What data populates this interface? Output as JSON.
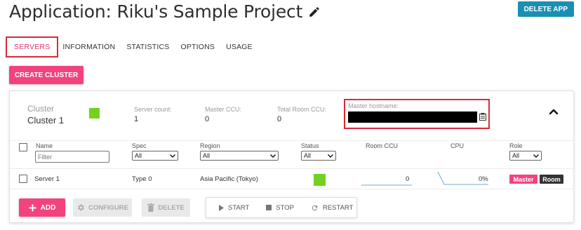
{
  "header": {
    "title": "Application: Riku's Sample Project",
    "edit_icon": "pencil-icon",
    "delete_app_label": "DELETE APP"
  },
  "tabs": [
    {
      "label": "SERVERS",
      "active": true
    },
    {
      "label": "INFORMATION",
      "active": false
    },
    {
      "label": "STATISTICS",
      "active": false
    },
    {
      "label": "OPTIONS",
      "active": false
    },
    {
      "label": "USAGE",
      "active": false
    }
  ],
  "create_cluster_label": "CREATE CLUSTER",
  "cluster": {
    "cluster_label": "Cluster",
    "cluster_name": "Cluster 1",
    "status_color": "#73d21f",
    "server_count_label": "Server count:",
    "server_count": "1",
    "master_ccu_label": "Master CCU:",
    "master_ccu": "0",
    "total_room_ccu_label": "Total Room CCU:",
    "total_room_ccu": "0",
    "master_hostname_label": "Master hostname:",
    "collapse_icon": "chevron-up-icon"
  },
  "table": {
    "columns": {
      "name": "Name",
      "spec": "Spec",
      "region": "Region",
      "status": "Status",
      "room_ccu": "Room CCU",
      "cpu": "CPU",
      "role": "Role"
    },
    "filter_placeholder": "Filter",
    "filters": {
      "spec": "All",
      "region": "All",
      "status": "All",
      "role": "All"
    },
    "rows": [
      {
        "name": "Server 1",
        "spec": "Type 0",
        "region": "Asia Pacific (Tokyo)",
        "status_color": "#73d21f",
        "room_ccu": "0",
        "cpu": "0%",
        "roles": [
          "Master",
          "Room"
        ]
      }
    ]
  },
  "actions": {
    "add": "ADD",
    "configure": "CONFIGURE",
    "delete": "DELETE",
    "start": "START",
    "stop": "STOP",
    "restart": "RESTART"
  },
  "colors": {
    "accent_pink": "#f2437e",
    "delete_app_blue": "#1a8fb3",
    "status_green": "#73d21f",
    "highlight_red": "#d92b3a",
    "master_badge": "#f2437e",
    "room_badge": "#333333"
  }
}
